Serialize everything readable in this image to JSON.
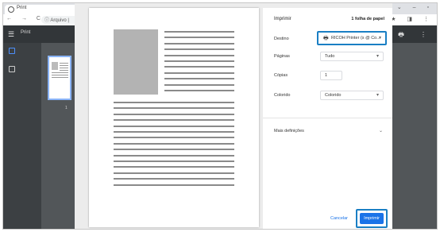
{
  "tab": {
    "title": "Print",
    "close": "×",
    "new_tab": "+"
  },
  "window_controls": "⌄ ‒ ▫",
  "address": {
    "info_label": "ⓘ Arquivo |",
    "nav": "← → C"
  },
  "addr_icons": "< ☆ ★ ◨ ⋮",
  "viewer": {
    "menu": "☰",
    "title": "Print",
    "tools": "✎ ⤓ 🖶 ⋮",
    "page_num": "1"
  },
  "print": {
    "title": "Imprimir",
    "sheet_count": "1 folha de papel",
    "destination_label": "Destino",
    "destination_value": "RICOH Printer (s @ Co...",
    "pages_label": "Páginas",
    "pages_value": "Tudo",
    "copies_label": "Cópias",
    "copies_value": "1",
    "color_label": "Colorido",
    "color_value": "Colorido",
    "more_settings": "Mais definições",
    "cancel": "Cancelar",
    "print_button": "Imprimir"
  },
  "colors": {
    "accent": "#1a73e8",
    "highlight": "#1a7fc4",
    "viewer_bg": "#525659"
  }
}
